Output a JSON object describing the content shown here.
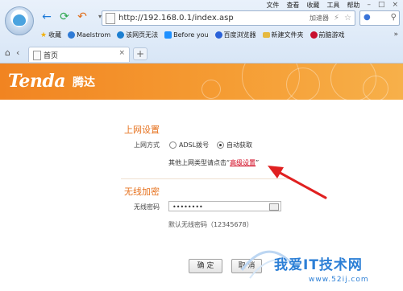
{
  "browser": {
    "menu": [
      "文件",
      "查看",
      "收藏",
      "工具",
      "帮助"
    ],
    "window_controls": [
      "–",
      "□",
      "×"
    ],
    "url": "http://192.168.0.1/index.asp",
    "accelerator_label": "加速器",
    "favorites": [
      {
        "label": "收藏",
        "icon": "star-icon",
        "color": "#f2b10c"
      },
      {
        "label": "Maelstrom",
        "icon": "globe-icon",
        "color": "#2f7bd6"
      },
      {
        "label": "该网页无法",
        "icon": "ie-icon",
        "color": "#1c7fd1"
      },
      {
        "label": "Before you",
        "icon": "windows-icon",
        "color": "#1e90ff"
      },
      {
        "label": "百度浏览器",
        "icon": "baidu-icon",
        "color": "#2a62d9"
      },
      {
        "label": "新建文件夹",
        "icon": "folder-icon",
        "color": "#e6b93f"
      },
      {
        "label": "前脑游戏",
        "icon": "game-icon",
        "color": "#c8102e"
      }
    ],
    "tab_label": "首页"
  },
  "banner": {
    "logo": "Tenda",
    "logo_cn": "腾达",
    "color": "#f18421"
  },
  "form": {
    "internet_title": "上网设置",
    "connection_label": "上网方式",
    "options": [
      {
        "label": "ADSL拨号",
        "selected": false
      },
      {
        "label": "自动获取",
        "selected": true
      }
    ],
    "hint_prefix": "其他上网类型请点击“",
    "hint_link": "高级设置",
    "hint_suffix": "”",
    "wireless_title": "无线加密",
    "password_label": "无线密码",
    "password_value": "••••••••",
    "password_note": "默认无线密码（12345678）",
    "ok_button": "确 定",
    "cancel_button": "取 消"
  },
  "watermark": {
    "text": "我爱IT技术网",
    "sub": "www.52ij.com"
  },
  "colors": {
    "accent": "#e6701c",
    "link": "#d0021b",
    "arrow": "#e02020"
  }
}
